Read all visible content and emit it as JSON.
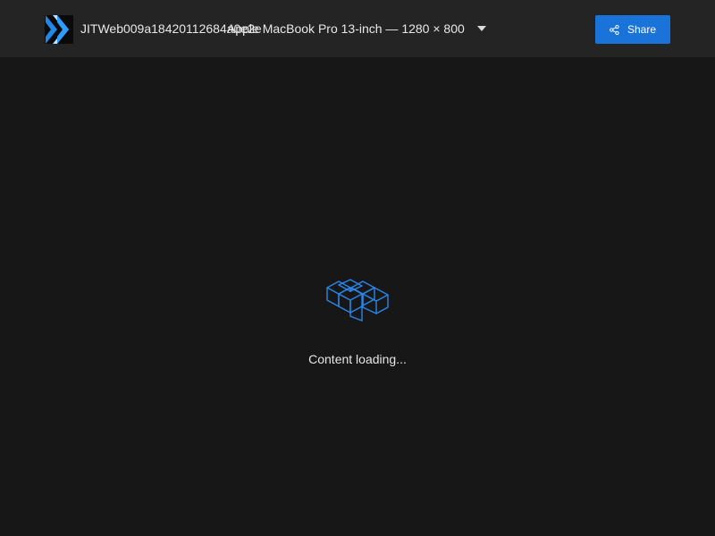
{
  "header": {
    "project_name": "JITWeb009a18420112684a0e2e",
    "device_selector": {
      "selected": "Apple MacBook Pro 13-inch — 1280 × 800"
    },
    "share_label": "Share"
  },
  "main": {
    "status_text": "Content loading..."
  },
  "icons": {
    "logo": "chevron-double-right-icon",
    "dropdown": "caret-down-icon",
    "share": "share-nodes-icon",
    "loader": "stacked-boxes-icon"
  },
  "colors": {
    "background": "#171718",
    "header_background": "#242425",
    "accent": "#1a73d9",
    "loader_stroke": "#2a86e8"
  }
}
